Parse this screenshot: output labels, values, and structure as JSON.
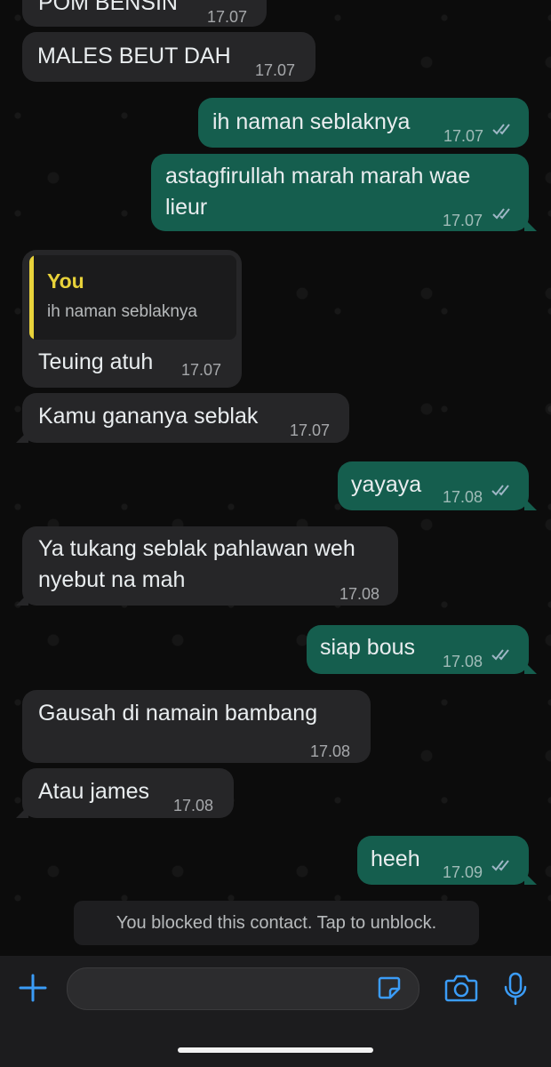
{
  "messages": [
    {
      "text": "POM BENSIN",
      "time": "17.07",
      "direction": "incoming"
    },
    {
      "text": "MALES BEUT DAH",
      "time": "17.07",
      "direction": "incoming"
    },
    {
      "text": "ih naman seblaknya",
      "time": "17.07",
      "direction": "outgoing",
      "read": true
    },
    {
      "text_line1": "astagfirullah marah marah wae",
      "text_line2": "lieur",
      "time": "17.07",
      "direction": "outgoing",
      "read": true
    },
    {
      "reply_to": {
        "author": "You",
        "text": "ih naman seblaknya"
      },
      "text": "Teuing atuh",
      "time": "17.07",
      "direction": "incoming"
    },
    {
      "text": "Kamu gananya seblak",
      "time": "17.07",
      "direction": "incoming"
    },
    {
      "text": "yayaya",
      "time": "17.08",
      "direction": "outgoing",
      "read": true
    },
    {
      "text_line1": "Ya tukang seblak pahlawan weh",
      "text_line2": "nyebut na mah",
      "time": "17.08",
      "direction": "incoming"
    },
    {
      "text": "siap bous",
      "time": "17.08",
      "direction": "outgoing",
      "read": true
    },
    {
      "text": "Gausah di namain bambang",
      "time": "17.08",
      "direction": "incoming"
    },
    {
      "text": "Atau james",
      "time": "17.08",
      "direction": "incoming"
    },
    {
      "text": "heeh",
      "time": "17.09",
      "direction": "outgoing",
      "read": true
    }
  ],
  "notice": "You blocked this contact. Tap to unblock.",
  "composer": {
    "placeholder": ""
  },
  "icons": {
    "add": "plus-icon",
    "sticker": "sticker-icon",
    "camera": "camera-icon",
    "mic": "microphone-icon",
    "ticks": "double-check-icon"
  },
  "colors": {
    "outgoing_bubble": "#155e4e",
    "incoming_bubble": "#262628",
    "accent": "#3b9cf7",
    "quote_author": "#e8d23a",
    "read_ticks": "#9fb7c6"
  }
}
